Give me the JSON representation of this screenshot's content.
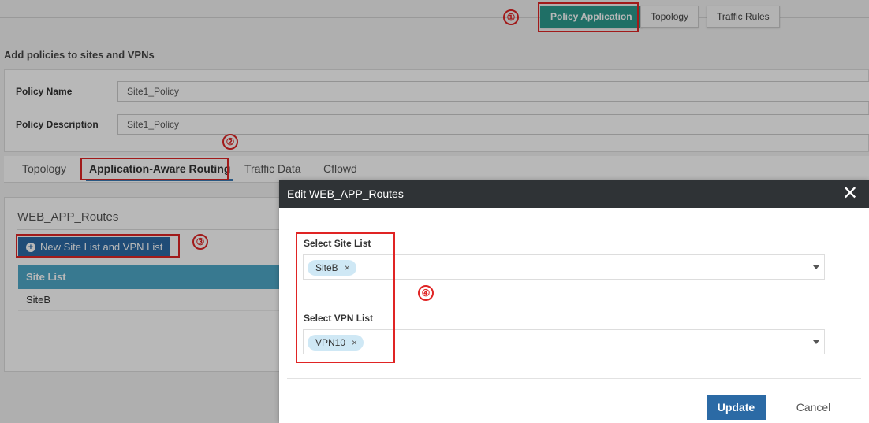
{
  "top_nav": {
    "buttons": [
      "Policy Application",
      "Topology",
      "Traffic Rules"
    ],
    "active": "Policy Application"
  },
  "section_title": "Add policies to sites and VPNs",
  "policy_form": {
    "name_label": "Policy Name",
    "name_value": "Site1_Policy",
    "desc_label": "Policy Description",
    "desc_value": "Site1_Policy"
  },
  "tabs": [
    "Topology",
    "Application-Aware Routing",
    "Traffic Data",
    "Cflowd"
  ],
  "active_tab": "Application-Aware Routing",
  "routes_panel": {
    "title": "WEB_APP_Routes",
    "new_button": "New Site List and VPN List",
    "column_header": "Site List",
    "rows": [
      "SiteB"
    ]
  },
  "modal": {
    "title": "Edit WEB_APP_Routes",
    "site_label": "Select Site List",
    "site_chip": "SiteB",
    "vpn_label": "Select VPN List",
    "vpn_chip": "VPN10",
    "update": "Update",
    "cancel": "Cancel"
  },
  "annotations": [
    "①",
    "②",
    "③",
    "④"
  ],
  "colors": {
    "accent_teal": "#2c9a8e",
    "primary_blue": "#2b6aa5",
    "header_blue": "#4ea8c8",
    "annotation_red": "#e02424",
    "modal_header": "#2f3336"
  },
  "icons": [
    "close-icon",
    "plus-circle-icon",
    "chip-remove-icon",
    "dropdown-caret-icon"
  ]
}
